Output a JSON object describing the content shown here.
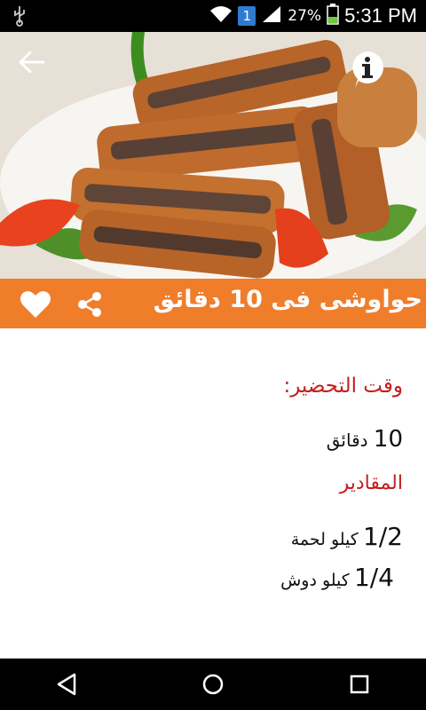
{
  "status_bar": {
    "usb_icon": "usb-icon",
    "notification_count": "1",
    "battery_percent": "27%",
    "time": "5:31 PM"
  },
  "header": {
    "back_icon": "arrow-left-icon",
    "info_icon": "info-icon"
  },
  "title_bar": {
    "title_prefix": "حواوشى فى",
    "title_number": "10",
    "title_suffix": "دقائق",
    "favorite_icon": "heart-icon",
    "share_icon": "share-icon",
    "accent_color": "#f07d2a"
  },
  "content": {
    "prep_time_label": "وقت التحضير:",
    "prep_time_number": "10",
    "prep_time_unit": "دقائق",
    "ingredients_label": "المقادير",
    "ingredients": [
      {
        "qty": "1/2",
        "item": "كيلو لحمة"
      },
      {
        "qty": "1/4",
        "item": "كيلو دوش"
      }
    ],
    "label_color": "#c41e1e"
  },
  "nav_bar": {
    "back": "nav-back-icon",
    "home": "nav-home-icon",
    "recents": "nav-recents-icon"
  }
}
